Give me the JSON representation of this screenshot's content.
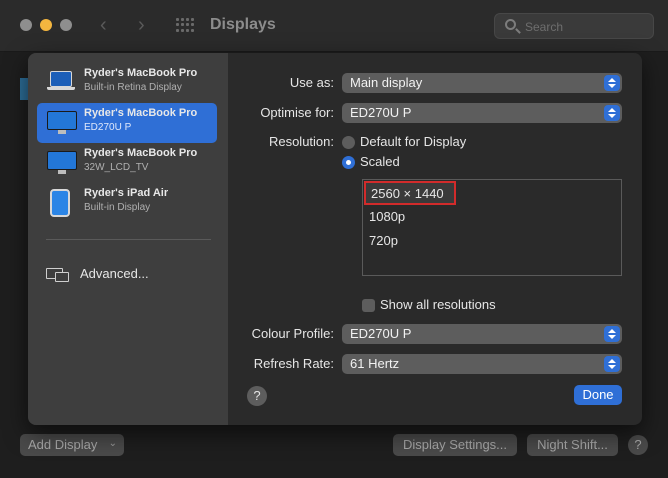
{
  "window": {
    "title": "Displays",
    "search_placeholder": "Search"
  },
  "sidebar": {
    "devices": [
      {
        "name": "Ryder's MacBook Pro",
        "sub": "Built-in Retina Display",
        "icon": "laptop-icon",
        "selected": false
      },
      {
        "name": "Ryder's MacBook Pro",
        "sub": "ED270U P",
        "icon": "monitor-icon",
        "selected": true
      },
      {
        "name": "Ryder's MacBook Pro",
        "sub": "32W_LCD_TV",
        "icon": "monitor-icon",
        "selected": false
      },
      {
        "name": "Ryder's iPad Air",
        "sub": "Built-in Display",
        "icon": "ipad-icon",
        "selected": false
      }
    ],
    "advanced_label": "Advanced..."
  },
  "form": {
    "use_as": {
      "label": "Use as:",
      "value": "Main display"
    },
    "optimise_for": {
      "label": "Optimise for:",
      "value": "ED270U P"
    },
    "resolution": {
      "label": "Resolution:",
      "options": [
        {
          "label": "Default for Display",
          "selected": false
        },
        {
          "label": "Scaled",
          "selected": true
        }
      ],
      "list": [
        "2560 × 1440",
        "1080p",
        "720p"
      ],
      "highlighted": "2560 × 1440"
    },
    "show_all_resolutions": {
      "label": "Show all resolutions",
      "checked": false
    },
    "colour_profile": {
      "label": "Colour Profile:",
      "value": "ED270U P"
    },
    "refresh_rate": {
      "label": "Refresh Rate:",
      "value": "61 Hertz"
    },
    "help_label": "?",
    "done_label": "Done"
  },
  "bottom_bar": {
    "add_display": "Add Display",
    "display_settings": "Display Settings...",
    "night_shift": "Night Shift...",
    "help_label": "?"
  },
  "colors": {
    "accent": "#2f6fd6",
    "highlight_border": "#d22b2b",
    "traffic_minimize": "#f4b63f"
  }
}
